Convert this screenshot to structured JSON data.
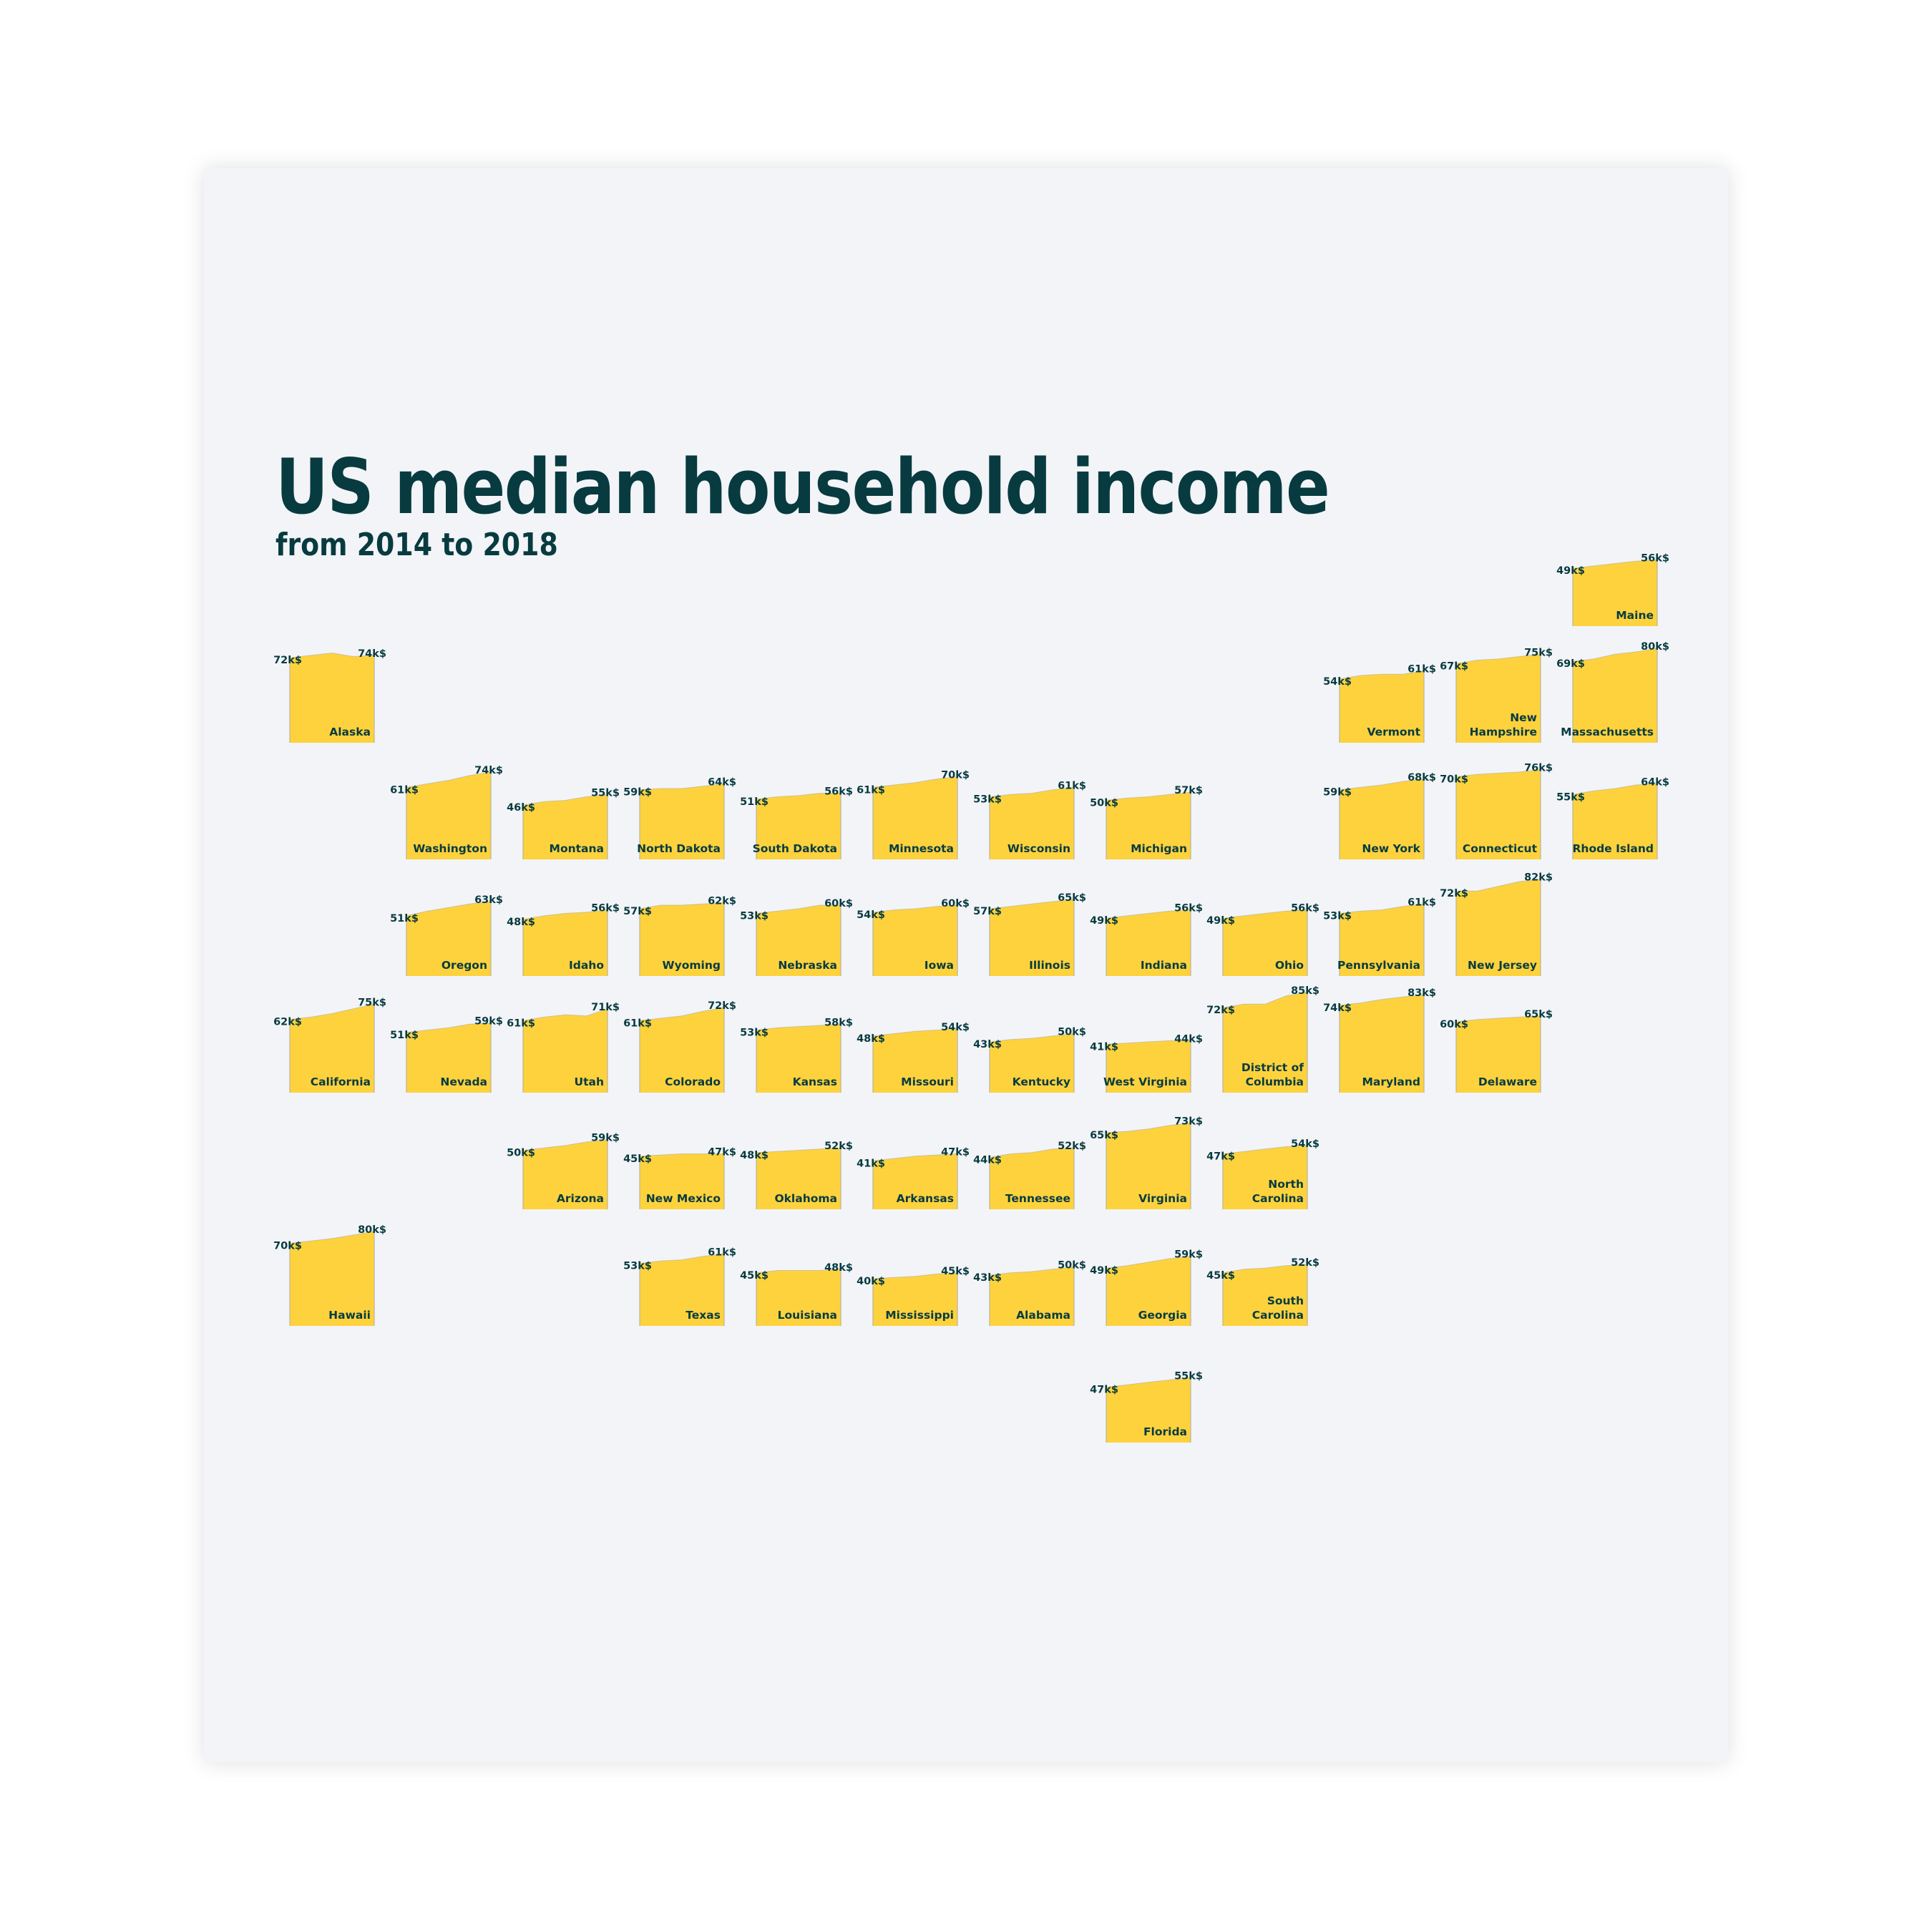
{
  "header": {
    "title": "US median household income",
    "subtitle": "from 2014 to 2018"
  },
  "colors": {
    "tile_fill": "#fed23d",
    "tile_edge": "#b9b49c",
    "text": "#073b40",
    "card_bg": "#f3f4f8"
  },
  "chart_data": {
    "type": "area",
    "title": "US median household income",
    "subtitle": "from 2014 to 2018",
    "layout": "tile-grid map of US states, one small area chart per state",
    "x": [
      2014,
      2015,
      2016,
      2017,
      2018
    ],
    "unit": "k$",
    "ylim": [
      0,
      85
    ],
    "series": [
      {
        "name": "Maine",
        "row": 0,
        "col": 11,
        "values": [
          49,
          51,
          53,
          55,
          56
        ],
        "start_label": "49k$",
        "end_label": "56k$"
      },
      {
        "name": "Alaska",
        "row": 1,
        "col": 0,
        "values": [
          72,
          74,
          76,
          73,
          74
        ],
        "start_label": "72k$",
        "end_label": "74k$"
      },
      {
        "name": "Vermont",
        "row": 1,
        "col": 9,
        "values": [
          54,
          57,
          58,
          58,
          61
        ],
        "start_label": "54k$",
        "end_label": "61k$"
      },
      {
        "name": "New Hampshire",
        "row": 1,
        "col": 10,
        "values": [
          67,
          70,
          71,
          73,
          75
        ],
        "start_label": "67k$",
        "end_label": "75k$"
      },
      {
        "name": "Massachusetts",
        "row": 1,
        "col": 11,
        "values": [
          69,
          71,
          75,
          77,
          80
        ],
        "start_label": "69k$",
        "end_label": "80k$"
      },
      {
        "name": "Washington",
        "row": 2,
        "col": 1,
        "values": [
          61,
          64,
          67,
          71,
          74
        ],
        "start_label": "61k$",
        "end_label": "74k$"
      },
      {
        "name": "Montana",
        "row": 2,
        "col": 2,
        "values": [
          46,
          49,
          50,
          53,
          55
        ],
        "start_label": "46k$",
        "end_label": "55k$"
      },
      {
        "name": "North Dakota",
        "row": 2,
        "col": 3,
        "values": [
          59,
          60,
          60,
          62,
          64
        ],
        "start_label": "59k$",
        "end_label": "64k$"
      },
      {
        "name": "South Dakota",
        "row": 2,
        "col": 4,
        "values": [
          51,
          53,
          54,
          56,
          56
        ],
        "start_label": "51k$",
        "end_label": "56k$"
      },
      {
        "name": "Minnesota",
        "row": 2,
        "col": 5,
        "values": [
          61,
          63,
          65,
          68,
          70
        ],
        "start_label": "61k$",
        "end_label": "70k$"
      },
      {
        "name": "Wisconsin",
        "row": 2,
        "col": 6,
        "values": [
          53,
          55,
          56,
          59,
          61
        ],
        "start_label": "53k$",
        "end_label": "61k$"
      },
      {
        "name": "Michigan",
        "row": 2,
        "col": 7,
        "values": [
          50,
          52,
          53,
          55,
          57
        ],
        "start_label": "50k$",
        "end_label": "57k$"
      },
      {
        "name": "New York",
        "row": 2,
        "col": 9,
        "values": [
          59,
          61,
          63,
          66,
          68
        ],
        "start_label": "59k$",
        "end_label": "68k$"
      },
      {
        "name": "Connecticut",
        "row": 2,
        "col": 10,
        "values": [
          70,
          72,
          73,
          74,
          76
        ],
        "start_label": "70k$",
        "end_label": "76k$"
      },
      {
        "name": "Rhode Island",
        "row": 2,
        "col": 11,
        "values": [
          55,
          58,
          60,
          63,
          64
        ],
        "start_label": "55k$",
        "end_label": "64k$"
      },
      {
        "name": "Oregon",
        "row": 3,
        "col": 1,
        "values": [
          51,
          55,
          58,
          61,
          63
        ],
        "start_label": "51k$",
        "end_label": "63k$"
      },
      {
        "name": "Idaho",
        "row": 3,
        "col": 2,
        "values": [
          48,
          51,
          53,
          54,
          56
        ],
        "start_label": "48k$",
        "end_label": "56k$"
      },
      {
        "name": "Wyoming",
        "row": 3,
        "col": 3,
        "values": [
          57,
          60,
          60,
          61,
          62
        ],
        "start_label": "57k$",
        "end_label": "62k$"
      },
      {
        "name": "Nebraska",
        "row": 3,
        "col": 4,
        "values": [
          53,
          55,
          57,
          60,
          60
        ],
        "start_label": "53k$",
        "end_label": "60k$"
      },
      {
        "name": "Iowa",
        "row": 3,
        "col": 5,
        "values": [
          54,
          56,
          57,
          59,
          60
        ],
        "start_label": "54k$",
        "end_label": "60k$"
      },
      {
        "name": "Illinois",
        "row": 3,
        "col": 6,
        "values": [
          57,
          59,
          61,
          63,
          65
        ],
        "start_label": "57k$",
        "end_label": "65k$"
      },
      {
        "name": "Indiana",
        "row": 3,
        "col": 7,
        "values": [
          49,
          51,
          53,
          55,
          56
        ],
        "start_label": "49k$",
        "end_label": "56k$"
      },
      {
        "name": "Ohio",
        "row": 3,
        "col": 8,
        "values": [
          49,
          51,
          53,
          55,
          56
        ],
        "start_label": "49k$",
        "end_label": "56k$"
      },
      {
        "name": "Pennsylvania",
        "row": 3,
        "col": 9,
        "values": [
          53,
          55,
          56,
          59,
          61
        ],
        "start_label": "53k$",
        "end_label": "61k$"
      },
      {
        "name": "New Jersey",
        "row": 3,
        "col": 10,
        "values": [
          72,
          72,
          76,
          80,
          82
        ],
        "start_label": "72k$",
        "end_label": "82k$"
      },
      {
        "name": "California",
        "row": 4,
        "col": 0,
        "values": [
          62,
          64,
          67,
          71,
          75
        ],
        "start_label": "62k$",
        "end_label": "75k$"
      },
      {
        "name": "Nevada",
        "row": 4,
        "col": 1,
        "values": [
          51,
          53,
          55,
          58,
          59
        ],
        "start_label": "51k$",
        "end_label": "59k$"
      },
      {
        "name": "Utah",
        "row": 4,
        "col": 2,
        "values": [
          61,
          64,
          66,
          65,
          71
        ],
        "start_label": "61k$",
        "end_label": "71k$"
      },
      {
        "name": "Colorado",
        "row": 4,
        "col": 3,
        "values": [
          61,
          63,
          65,
          69,
          72
        ],
        "start_label": "61k$",
        "end_label": "72k$"
      },
      {
        "name": "Kansas",
        "row": 4,
        "col": 4,
        "values": [
          53,
          55,
          56,
          57,
          58
        ],
        "start_label": "53k$",
        "end_label": "58k$"
      },
      {
        "name": "Missouri",
        "row": 4,
        "col": 5,
        "values": [
          48,
          50,
          52,
          53,
          54
        ],
        "start_label": "48k$",
        "end_label": "54k$"
      },
      {
        "name": "Kentucky",
        "row": 4,
        "col": 6,
        "values": [
          43,
          45,
          46,
          48,
          50
        ],
        "start_label": "43k$",
        "end_label": "50k$"
      },
      {
        "name": "West Virginia",
        "row": 4,
        "col": 7,
        "values": [
          41,
          42,
          43,
          44,
          44
        ],
        "start_label": "41k$",
        "end_label": "44k$"
      },
      {
        "name": "District of Columbia",
        "row": 4,
        "col": 8,
        "values": [
          72,
          75,
          75,
          82,
          85
        ],
        "start_label": "72k$",
        "end_label": "85k$"
      },
      {
        "name": "Maryland",
        "row": 4,
        "col": 9,
        "values": [
          74,
          76,
          79,
          81,
          83
        ],
        "start_label": "74k$",
        "end_label": "83k$"
      },
      {
        "name": "Delaware",
        "row": 4,
        "col": 10,
        "values": [
          60,
          62,
          63,
          64,
          65
        ],
        "start_label": "60k$",
        "end_label": "65k$"
      },
      {
        "name": "Arizona",
        "row": 5,
        "col": 2,
        "values": [
          50,
          52,
          54,
          57,
          59
        ],
        "start_label": "50k$",
        "end_label": "59k$"
      },
      {
        "name": "New Mexico",
        "row": 5,
        "col": 3,
        "values": [
          45,
          46,
          47,
          47,
          47
        ],
        "start_label": "45k$",
        "end_label": "47k$"
      },
      {
        "name": "Oklahoma",
        "row": 5,
        "col": 4,
        "values": [
          48,
          49,
          50,
          51,
          52
        ],
        "start_label": "48k$",
        "end_label": "52k$"
      },
      {
        "name": "Arkansas",
        "row": 5,
        "col": 5,
        "values": [
          41,
          43,
          45,
          46,
          47
        ],
        "start_label": "41k$",
        "end_label": "47k$"
      },
      {
        "name": "Tennessee",
        "row": 5,
        "col": 6,
        "values": [
          44,
          47,
          48,
          51,
          52
        ],
        "start_label": "44k$",
        "end_label": "52k$"
      },
      {
        "name": "Virginia",
        "row": 5,
        "col": 7,
        "values": [
          65,
          66,
          68,
          71,
          73
        ],
        "start_label": "65k$",
        "end_label": "73k$"
      },
      {
        "name": "North Carolina",
        "row": 5,
        "col": 8,
        "values": [
          47,
          49,
          51,
          53,
          54
        ],
        "start_label": "47k$",
        "end_label": "54k$"
      },
      {
        "name": "Hawaii",
        "row": 6,
        "col": 0,
        "values": [
          70,
          72,
          74,
          77,
          80
        ],
        "start_label": "70k$",
        "end_label": "80k$"
      },
      {
        "name": "Texas",
        "row": 6,
        "col": 3,
        "values": [
          53,
          55,
          56,
          59,
          61
        ],
        "start_label": "53k$",
        "end_label": "61k$"
      },
      {
        "name": "Louisiana",
        "row": 6,
        "col": 4,
        "values": [
          45,
          47,
          47,
          47,
          48
        ],
        "start_label": "45k$",
        "end_label": "48k$"
      },
      {
        "name": "Mississippi",
        "row": 6,
        "col": 5,
        "values": [
          40,
          41,
          42,
          44,
          45
        ],
        "start_label": "40k$",
        "end_label": "45k$"
      },
      {
        "name": "Alabama",
        "row": 6,
        "col": 6,
        "values": [
          43,
          45,
          46,
          48,
          50
        ],
        "start_label": "43k$",
        "end_label": "50k$"
      },
      {
        "name": "Georgia",
        "row": 6,
        "col": 7,
        "values": [
          49,
          51,
          54,
          57,
          59
        ],
        "start_label": "49k$",
        "end_label": "59k$"
      },
      {
        "name": "South Carolina",
        "row": 6,
        "col": 8,
        "values": [
          45,
          48,
          49,
          51,
          52
        ],
        "start_label": "45k$",
        "end_label": "52k$"
      },
      {
        "name": "Florida",
        "row": 7,
        "col": 7,
        "values": [
          47,
          49,
          51,
          53,
          55
        ],
        "start_label": "47k$",
        "end_label": "55k$"
      }
    ],
    "label_wraps": {
      "New Hampshire": [
        "New",
        "Hampshire"
      ],
      "District of Columbia": [
        "District of",
        "Columbia"
      ],
      "North Carolina": [
        "North",
        "Carolina"
      ],
      "South Carolina": [
        "South",
        "Carolina"
      ]
    }
  }
}
